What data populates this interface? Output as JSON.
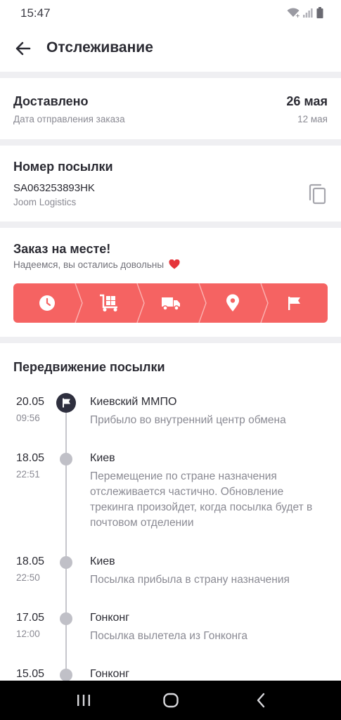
{
  "status_bar": {
    "time": "15:47",
    "icons": [
      "wifi-icon",
      "signal-icon",
      "battery-icon"
    ]
  },
  "header": {
    "title": "Отслеживание",
    "back_icon": "arrow-left-icon"
  },
  "delivery": {
    "status": "Доставлено",
    "status_sub": "Дата отправления заказа",
    "date": "26 мая",
    "date_sub": "12 мая"
  },
  "parcel": {
    "title": "Номер посылки",
    "number": "SA063253893HK",
    "carrier": "Joom Logistics",
    "copy_icon": "copy-icon"
  },
  "arrival": {
    "title": "Заказ на месте!",
    "subtitle": "Надеемся, вы остались довольны",
    "heart_icon": "heart-icon",
    "accent_color": "#f56362",
    "stages": [
      "clock-icon",
      "cart-boxes-icon",
      "truck-icon",
      "location-pin-icon",
      "flag-icon"
    ]
  },
  "movement": {
    "title": "Передвижение посылки",
    "events": [
      {
        "date": "20.05",
        "time": "09:56",
        "place": "Киевский ММПО",
        "description": "Прибыло во внутренний центр обмена"
      },
      {
        "date": "18.05",
        "time": "22:51",
        "place": "Киев",
        "description": "Перемещение по стране назначения отслеживается частично. Обновление трекинга произойдет, когда посылка будет в почтовом отделении"
      },
      {
        "date": "18.05",
        "time": "22:50",
        "place": "Киев",
        "description": "Посылка прибыла в страну назначения"
      },
      {
        "date": "17.05",
        "time": "12:00",
        "place": "Гонконг",
        "description": "Посылка вылетела из Гонконга"
      },
      {
        "date": "15.05",
        "time": "",
        "place": "Гонконг",
        "description": ""
      }
    ]
  },
  "nav_bar": {
    "icons": [
      "recent-apps-icon",
      "home-icon",
      "back-nav-icon"
    ]
  }
}
